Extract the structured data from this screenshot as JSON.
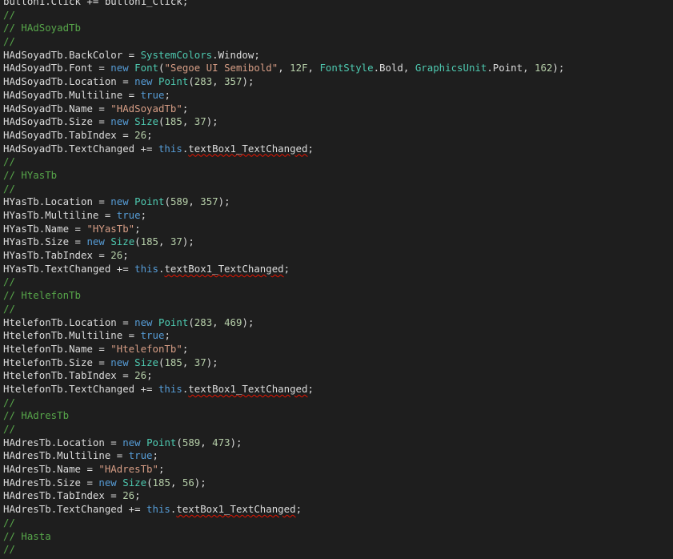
{
  "editor": {
    "theme_colors": {
      "background": "#1e1e1e",
      "text": "#dcdcdc",
      "comment": "#57a64a",
      "keyword": "#569cd6",
      "type": "#4ec9b0",
      "string": "#d69d85",
      "number": "#b5cea8",
      "method": "#dcdcaa",
      "error_squiggle": "#e51400"
    },
    "lines": [
      [
        {
          "t": "button1",
          "c": "ident"
        },
        {
          "t": ".Click += ",
          "c": "ident"
        },
        {
          "t": "button1_Click",
          "c": "ident"
        },
        {
          "t": ";",
          "c": "ident"
        }
      ],
      [
        {
          "t": "//",
          "c": "comment"
        }
      ],
      [
        {
          "t": "// HAdSoyadTb",
          "c": "comment"
        }
      ],
      [
        {
          "t": "//",
          "c": "comment"
        }
      ],
      [
        {
          "t": "HAdSoyadTb",
          "c": "ident"
        },
        {
          "t": ".BackColor = ",
          "c": "ident"
        },
        {
          "t": "SystemColors",
          "c": "type"
        },
        {
          "t": ".Window;",
          "c": "ident"
        }
      ],
      [
        {
          "t": "HAdSoyadTb",
          "c": "ident"
        },
        {
          "t": ".Font = ",
          "c": "ident"
        },
        {
          "t": "new",
          "c": "keyword"
        },
        {
          "t": " ",
          "c": "ident"
        },
        {
          "t": "Font",
          "c": "type"
        },
        {
          "t": "(",
          "c": "ident"
        },
        {
          "t": "\"Segoe UI Semibold\"",
          "c": "string"
        },
        {
          "t": ", ",
          "c": "ident"
        },
        {
          "t": "12F",
          "c": "number"
        },
        {
          "t": ", ",
          "c": "ident"
        },
        {
          "t": "FontStyle",
          "c": "type"
        },
        {
          "t": ".Bold, ",
          "c": "ident"
        },
        {
          "t": "GraphicsUnit",
          "c": "type"
        },
        {
          "t": ".Point, ",
          "c": "ident"
        },
        {
          "t": "162",
          "c": "number"
        },
        {
          "t": ");",
          "c": "ident"
        }
      ],
      [
        {
          "t": "HAdSoyadTb",
          "c": "ident"
        },
        {
          "t": ".Location = ",
          "c": "ident"
        },
        {
          "t": "new",
          "c": "keyword"
        },
        {
          "t": " ",
          "c": "ident"
        },
        {
          "t": "Point",
          "c": "type"
        },
        {
          "t": "(",
          "c": "ident"
        },
        {
          "t": "283",
          "c": "number"
        },
        {
          "t": ", ",
          "c": "ident"
        },
        {
          "t": "357",
          "c": "number"
        },
        {
          "t": ");",
          "c": "ident"
        }
      ],
      [
        {
          "t": "HAdSoyadTb",
          "c": "ident"
        },
        {
          "t": ".Multiline = ",
          "c": "ident"
        },
        {
          "t": "true",
          "c": "keyword"
        },
        {
          "t": ";",
          "c": "ident"
        }
      ],
      [
        {
          "t": "HAdSoyadTb",
          "c": "ident"
        },
        {
          "t": ".Name = ",
          "c": "ident"
        },
        {
          "t": "\"HAdSoyadTb\"",
          "c": "string"
        },
        {
          "t": ";",
          "c": "ident"
        }
      ],
      [
        {
          "t": "HAdSoyadTb",
          "c": "ident"
        },
        {
          "t": ".Size = ",
          "c": "ident"
        },
        {
          "t": "new",
          "c": "keyword"
        },
        {
          "t": " ",
          "c": "ident"
        },
        {
          "t": "Size",
          "c": "type"
        },
        {
          "t": "(",
          "c": "ident"
        },
        {
          "t": "185",
          "c": "number"
        },
        {
          "t": ", ",
          "c": "ident"
        },
        {
          "t": "37",
          "c": "number"
        },
        {
          "t": ");",
          "c": "ident"
        }
      ],
      [
        {
          "t": "HAdSoyadTb",
          "c": "ident"
        },
        {
          "t": ".TabIndex = ",
          "c": "ident"
        },
        {
          "t": "26",
          "c": "number"
        },
        {
          "t": ";",
          "c": "ident"
        }
      ],
      [
        {
          "t": "HAdSoyadTb",
          "c": "ident"
        },
        {
          "t": ".TextChanged += ",
          "c": "ident"
        },
        {
          "t": "this",
          "c": "keyword"
        },
        {
          "t": ".",
          "c": "ident"
        },
        {
          "t": "textBox1_TextChanged",
          "c": "ident",
          "u": true
        },
        {
          "t": ";",
          "c": "ident"
        }
      ],
      [
        {
          "t": "//",
          "c": "comment"
        }
      ],
      [
        {
          "t": "// HYasTb",
          "c": "comment"
        }
      ],
      [
        {
          "t": "//",
          "c": "comment"
        }
      ],
      [
        {
          "t": "HYasTb",
          "c": "ident"
        },
        {
          "t": ".Location = ",
          "c": "ident"
        },
        {
          "t": "new",
          "c": "keyword"
        },
        {
          "t": " ",
          "c": "ident"
        },
        {
          "t": "Point",
          "c": "type"
        },
        {
          "t": "(",
          "c": "ident"
        },
        {
          "t": "589",
          "c": "number"
        },
        {
          "t": ", ",
          "c": "ident"
        },
        {
          "t": "357",
          "c": "number"
        },
        {
          "t": ");",
          "c": "ident"
        }
      ],
      [
        {
          "t": "HYasTb",
          "c": "ident"
        },
        {
          "t": ".Multiline = ",
          "c": "ident"
        },
        {
          "t": "true",
          "c": "keyword"
        },
        {
          "t": ";",
          "c": "ident"
        }
      ],
      [
        {
          "t": "HYasTb",
          "c": "ident"
        },
        {
          "t": ".Name = ",
          "c": "ident"
        },
        {
          "t": "\"HYasTb\"",
          "c": "string"
        },
        {
          "t": ";",
          "c": "ident"
        }
      ],
      [
        {
          "t": "HYasTb",
          "c": "ident"
        },
        {
          "t": ".Size = ",
          "c": "ident"
        },
        {
          "t": "new",
          "c": "keyword"
        },
        {
          "t": " ",
          "c": "ident"
        },
        {
          "t": "Size",
          "c": "type"
        },
        {
          "t": "(",
          "c": "ident"
        },
        {
          "t": "185",
          "c": "number"
        },
        {
          "t": ", ",
          "c": "ident"
        },
        {
          "t": "37",
          "c": "number"
        },
        {
          "t": ");",
          "c": "ident"
        }
      ],
      [
        {
          "t": "HYasTb",
          "c": "ident"
        },
        {
          "t": ".TabIndex = ",
          "c": "ident"
        },
        {
          "t": "26",
          "c": "number"
        },
        {
          "t": ";",
          "c": "ident"
        }
      ],
      [
        {
          "t": "HYasTb",
          "c": "ident"
        },
        {
          "t": ".TextChanged += ",
          "c": "ident"
        },
        {
          "t": "this",
          "c": "keyword"
        },
        {
          "t": ".",
          "c": "ident"
        },
        {
          "t": "textBox1_TextChanged",
          "c": "ident",
          "u": true
        },
        {
          "t": ";",
          "c": "ident"
        }
      ],
      [
        {
          "t": "//",
          "c": "comment"
        }
      ],
      [
        {
          "t": "// HtelefonTb",
          "c": "comment"
        }
      ],
      [
        {
          "t": "//",
          "c": "comment"
        }
      ],
      [
        {
          "t": "HtelefonTb",
          "c": "ident"
        },
        {
          "t": ".Location = ",
          "c": "ident"
        },
        {
          "t": "new",
          "c": "keyword"
        },
        {
          "t": " ",
          "c": "ident"
        },
        {
          "t": "Point",
          "c": "type"
        },
        {
          "t": "(",
          "c": "ident"
        },
        {
          "t": "283",
          "c": "number"
        },
        {
          "t": ", ",
          "c": "ident"
        },
        {
          "t": "469",
          "c": "number"
        },
        {
          "t": ");",
          "c": "ident"
        }
      ],
      [
        {
          "t": "HtelefonTb",
          "c": "ident"
        },
        {
          "t": ".Multiline = ",
          "c": "ident"
        },
        {
          "t": "true",
          "c": "keyword"
        },
        {
          "t": ";",
          "c": "ident"
        }
      ],
      [
        {
          "t": "HtelefonTb",
          "c": "ident"
        },
        {
          "t": ".Name = ",
          "c": "ident"
        },
        {
          "t": "\"HtelefonTb\"",
          "c": "string"
        },
        {
          "t": ";",
          "c": "ident"
        }
      ],
      [
        {
          "t": "HtelefonTb",
          "c": "ident"
        },
        {
          "t": ".Size = ",
          "c": "ident"
        },
        {
          "t": "new",
          "c": "keyword"
        },
        {
          "t": " ",
          "c": "ident"
        },
        {
          "t": "Size",
          "c": "type"
        },
        {
          "t": "(",
          "c": "ident"
        },
        {
          "t": "185",
          "c": "number"
        },
        {
          "t": ", ",
          "c": "ident"
        },
        {
          "t": "37",
          "c": "number"
        },
        {
          "t": ");",
          "c": "ident"
        }
      ],
      [
        {
          "t": "HtelefonTb",
          "c": "ident"
        },
        {
          "t": ".TabIndex = ",
          "c": "ident"
        },
        {
          "t": "26",
          "c": "number"
        },
        {
          "t": ";",
          "c": "ident"
        }
      ],
      [
        {
          "t": "HtelefonTb",
          "c": "ident"
        },
        {
          "t": ".TextChanged += ",
          "c": "ident"
        },
        {
          "t": "this",
          "c": "keyword"
        },
        {
          "t": ".",
          "c": "ident"
        },
        {
          "t": "textBox1_TextChanged",
          "c": "ident",
          "u": true
        },
        {
          "t": ";",
          "c": "ident"
        }
      ],
      [
        {
          "t": "//",
          "c": "comment"
        }
      ],
      [
        {
          "t": "// HAdresTb",
          "c": "comment"
        }
      ],
      [
        {
          "t": "//",
          "c": "comment"
        }
      ],
      [
        {
          "t": "HAdresTb",
          "c": "ident"
        },
        {
          "t": ".Location = ",
          "c": "ident"
        },
        {
          "t": "new",
          "c": "keyword"
        },
        {
          "t": " ",
          "c": "ident"
        },
        {
          "t": "Point",
          "c": "type"
        },
        {
          "t": "(",
          "c": "ident"
        },
        {
          "t": "589",
          "c": "number"
        },
        {
          "t": ", ",
          "c": "ident"
        },
        {
          "t": "473",
          "c": "number"
        },
        {
          "t": ");",
          "c": "ident"
        }
      ],
      [
        {
          "t": "HAdresTb",
          "c": "ident"
        },
        {
          "t": ".Multiline = ",
          "c": "ident"
        },
        {
          "t": "true",
          "c": "keyword"
        },
        {
          "t": ";",
          "c": "ident"
        }
      ],
      [
        {
          "t": "HAdresTb",
          "c": "ident"
        },
        {
          "t": ".Name = ",
          "c": "ident"
        },
        {
          "t": "\"HAdresTb\"",
          "c": "string"
        },
        {
          "t": ";",
          "c": "ident"
        }
      ],
      [
        {
          "t": "HAdresTb",
          "c": "ident"
        },
        {
          "t": ".Size = ",
          "c": "ident"
        },
        {
          "t": "new",
          "c": "keyword"
        },
        {
          "t": " ",
          "c": "ident"
        },
        {
          "t": "Size",
          "c": "type"
        },
        {
          "t": "(",
          "c": "ident"
        },
        {
          "t": "185",
          "c": "number"
        },
        {
          "t": ", ",
          "c": "ident"
        },
        {
          "t": "56",
          "c": "number"
        },
        {
          "t": ");",
          "c": "ident"
        }
      ],
      [
        {
          "t": "HAdresTb",
          "c": "ident"
        },
        {
          "t": ".TabIndex = ",
          "c": "ident"
        },
        {
          "t": "26",
          "c": "number"
        },
        {
          "t": ";",
          "c": "ident"
        }
      ],
      [
        {
          "t": "HAdresTb",
          "c": "ident"
        },
        {
          "t": ".TextChanged += ",
          "c": "ident"
        },
        {
          "t": "this",
          "c": "keyword"
        },
        {
          "t": ".",
          "c": "ident"
        },
        {
          "t": "textBox1_TextChanged",
          "c": "ident",
          "u": true
        },
        {
          "t": ";",
          "c": "ident"
        }
      ],
      [
        {
          "t": "//",
          "c": "comment"
        }
      ],
      [
        {
          "t": "// Hasta",
          "c": "comment"
        }
      ],
      [
        {
          "t": "//",
          "c": "comment"
        }
      ]
    ]
  }
}
